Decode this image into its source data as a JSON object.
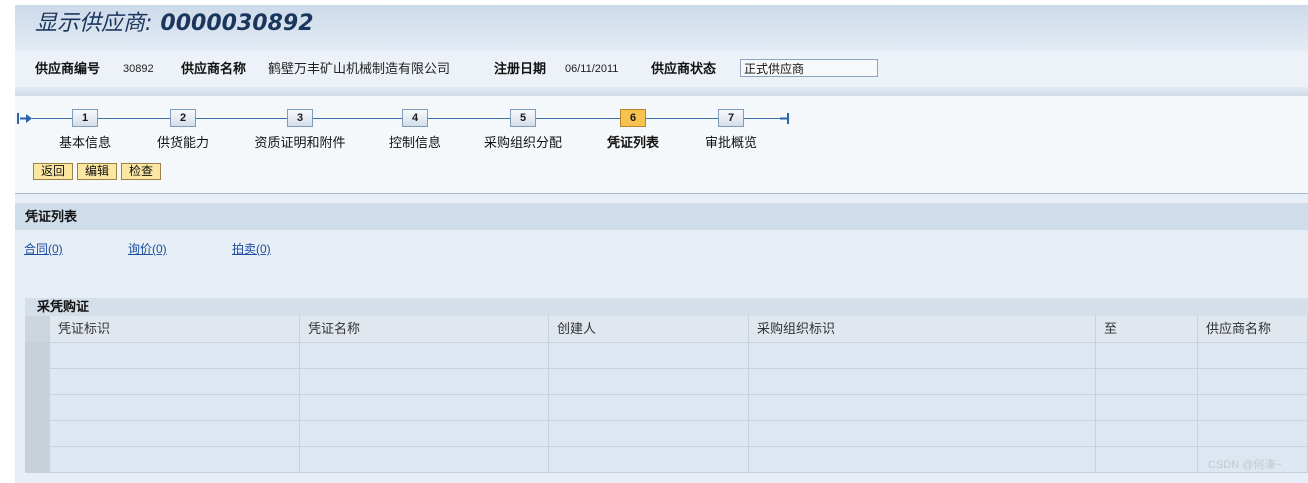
{
  "header": {
    "title_label": "显示供应商:",
    "title_id": "0000030892"
  },
  "vendor_info": {
    "number_label": "供应商编号",
    "number_value": "30892",
    "name_label": "供应商名称",
    "name_value": "鹤壁万丰矿山机械制造有限公司",
    "date_label": "注册日期",
    "date_value": "06/11/2011",
    "status_label": "供应商状态",
    "status_value": "正式供应商"
  },
  "roadmap": {
    "start_icon": "roadmap-start-icon",
    "end_icon": "roadmap-end-icon",
    "steps": [
      {
        "number": "1",
        "label": "基本信息",
        "active": false
      },
      {
        "number": "2",
        "label": "供货能力",
        "active": false
      },
      {
        "number": "3",
        "label": "资质证明和附件",
        "active": false
      },
      {
        "number": "4",
        "label": "控制信息",
        "active": false
      },
      {
        "number": "5",
        "label": "采购组织分配",
        "active": false
      },
      {
        "number": "6",
        "label": "凭证列表",
        "active": true
      },
      {
        "number": "7",
        "label": "审批概览",
        "active": false
      }
    ]
  },
  "toolbar": {
    "back_label": "返回",
    "edit_label": "编辑",
    "check_label": "检查"
  },
  "section": {
    "title": "凭证列表"
  },
  "document_links": [
    {
      "label": "合同(0)"
    },
    {
      "label": "询价(0)"
    },
    {
      "label": "拍卖(0)"
    }
  ],
  "table": {
    "title": "采凭购证",
    "columns": [
      "凭证标识",
      "凭证名称",
      "创建人",
      "采购组织标识",
      "至",
      "供应商名称"
    ],
    "rows": []
  },
  "watermark": "CSDN @何溱~",
  "colors": {
    "title_text": "#1b365d",
    "link": "#1c4da1",
    "active_step": "#f7c24f",
    "button": "#fbe7a1",
    "section_band": "#cfdcea"
  }
}
